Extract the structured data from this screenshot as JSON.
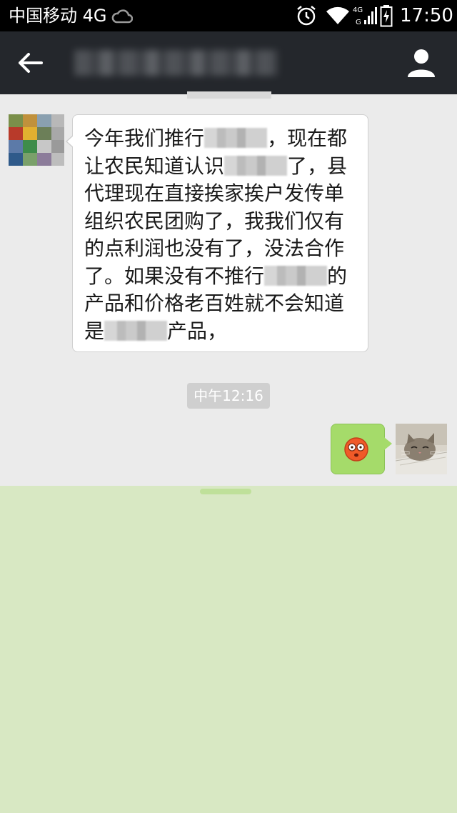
{
  "status_bar": {
    "carrier": "中国移动 4G",
    "time": "17:50",
    "network_small": "4G",
    "network_small_g": "G"
  },
  "nav": {
    "title": "",
    "back_icon": "back-arrow-icon",
    "profile_icon": "profile-icon"
  },
  "messages": [
    {
      "direction": "incoming",
      "lines": [
        {
          "before": "今年我们推行",
          "after": "，现在都",
          "redacted": true
        },
        {
          "before": "让农民知道认识",
          "after": "了，县",
          "redacted": true
        },
        {
          "before": "代理现在直接挨家挨户发传单",
          "after": "",
          "redacted": false
        },
        {
          "before": "组织农民团购了，我我们仅有",
          "after": "",
          "redacted": false
        },
        {
          "before": "的点利润也没有了，没法合作",
          "after": "",
          "redacted": false
        },
        {
          "before": "了。如果没有不推行",
          "after": "的",
          "redacted": true
        },
        {
          "before": "产品和价格老百姓就不会知道",
          "after": "",
          "redacted": false
        },
        {
          "before": "是",
          "after": "产品，",
          "redacted": true
        }
      ]
    },
    {
      "direction": "outgoing",
      "content": "emoji",
      "emoji_icon": "dizzy-face-emoji-icon"
    }
  ],
  "timestamp": "中午12:16",
  "colors": {
    "nav_bg": "#24272c",
    "chat_bg": "#ebebeb",
    "outgoing_bubble": "#a5db6a",
    "timestamp_bg": "#cfcfcf",
    "overlay": "#d8e8c3"
  }
}
